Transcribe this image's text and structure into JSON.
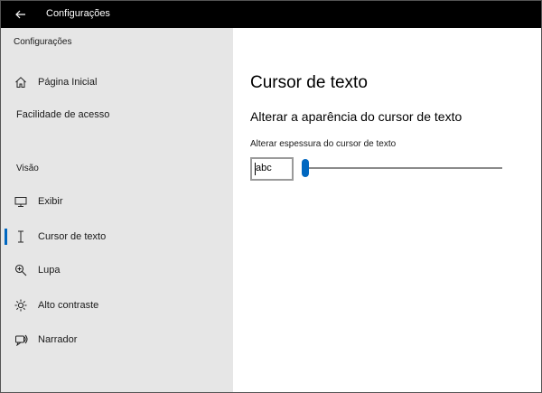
{
  "window": {
    "title": "Configurações"
  },
  "sidebar": {
    "heading": "Configurações",
    "home_label": "Página Inicial",
    "ease_label": "Facilidade de acesso",
    "section_label": "Visão",
    "items": [
      {
        "label": "Exibir",
        "icon": "monitor-icon"
      },
      {
        "label": "Cursor de texto",
        "icon": "text-cursor-icon",
        "active": true
      },
      {
        "label": "Lupa",
        "icon": "magnifier-icon"
      },
      {
        "label": "Alto contraste",
        "icon": "brightness-icon"
      },
      {
        "label": "Narrador",
        "icon": "narrator-icon"
      }
    ]
  },
  "content": {
    "title": "Cursor de texto",
    "subheading": "Alterar a aparência do cursor de texto",
    "slider_label": "Alterar espessura do cursor de texto",
    "preview_text": "abc",
    "slider_value_fraction": 0.0
  },
  "colors": {
    "accent": "#0067c0",
    "titlebar": "#000000",
    "sidebar_bg": "#e6e6e6",
    "content_bg": "#ffffff"
  }
}
